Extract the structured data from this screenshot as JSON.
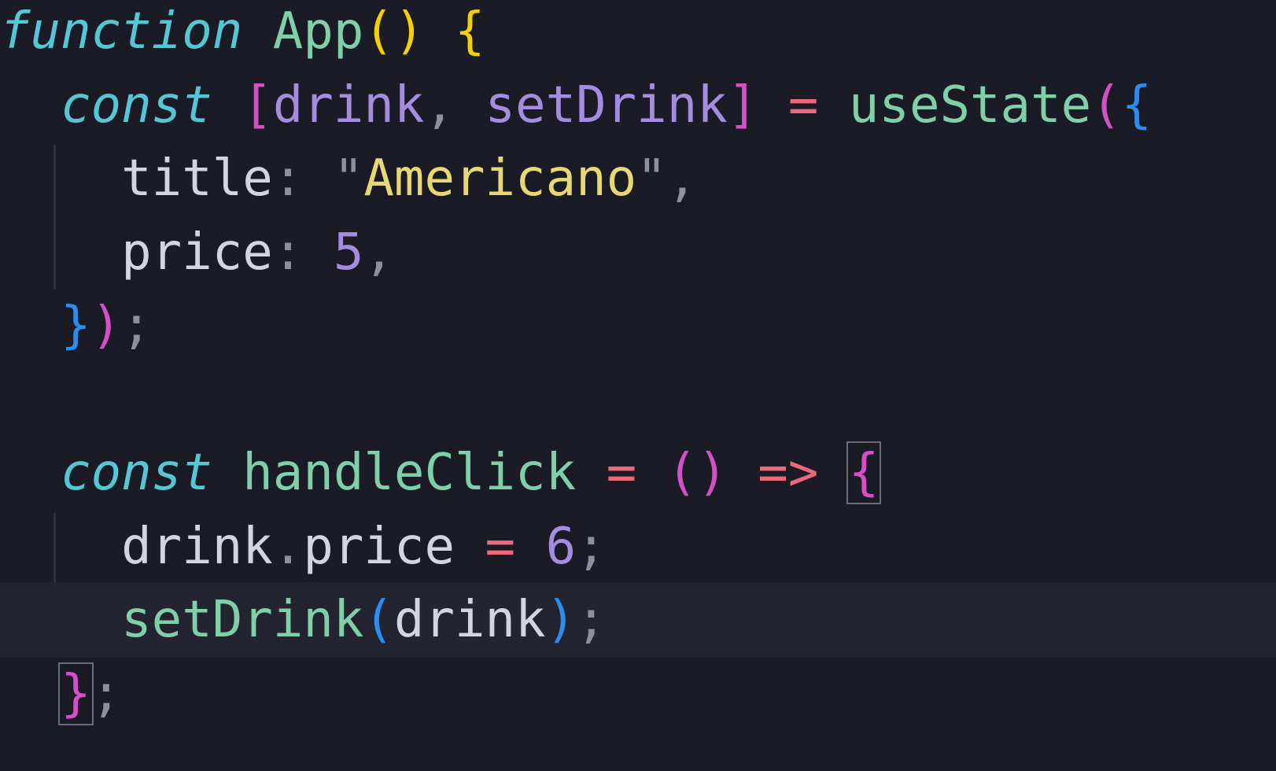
{
  "editor": {
    "colors": {
      "background": "#1a1b25",
      "current_line": "#23242f",
      "keyword": "#54c6d4",
      "function_name": "#7fcfa8",
      "variable": "#d2d4de",
      "destructure": "#a48ce0",
      "string": "#e8d873",
      "number": "#a48ce0",
      "operator": "#f0667a",
      "bracket_yellow": "#f5d000",
      "bracket_blue": "#2a8df0",
      "bracket_magenta": "#d44fc8",
      "punctuation": "#8e909c"
    },
    "lines": [
      {
        "tokens": [
          {
            "text": "function",
            "color": "#54c6d4",
            "italic": true
          },
          {
            "text": " ",
            "color": "#d2d4de"
          },
          {
            "text": "App",
            "color": "#7fcfa8"
          },
          {
            "text": "()",
            "color": "#f5d000"
          },
          {
            "text": " ",
            "color": "#d2d4de"
          },
          {
            "text": "{",
            "color": "#f5d000"
          }
        ]
      },
      {
        "tokens": [
          {
            "text": "  ",
            "color": "#d2d4de"
          },
          {
            "text": "const",
            "color": "#54c6d4",
            "italic": true
          },
          {
            "text": " ",
            "color": "#d2d4de"
          },
          {
            "text": "[",
            "color": "#d44fc8"
          },
          {
            "text": "drink",
            "color": "#a48ce0"
          },
          {
            "text": ",",
            "color": "#8e909c"
          },
          {
            "text": " ",
            "color": "#d2d4de"
          },
          {
            "text": "setDrink",
            "color": "#a48ce0"
          },
          {
            "text": "]",
            "color": "#d44fc8"
          },
          {
            "text": " ",
            "color": "#d2d4de"
          },
          {
            "text": "=",
            "color": "#f0667a"
          },
          {
            "text": " ",
            "color": "#d2d4de"
          },
          {
            "text": "useState",
            "color": "#7fcfa8"
          },
          {
            "text": "(",
            "color": "#d44fc8"
          },
          {
            "text": "{",
            "color": "#2a8df0"
          }
        ]
      },
      {
        "tokens": [
          {
            "text": "    ",
            "color": "#d2d4de"
          },
          {
            "text": "title",
            "color": "#d2d4de"
          },
          {
            "text": ":",
            "color": "#8e909c"
          },
          {
            "text": " ",
            "color": "#d2d4de"
          },
          {
            "text": "\"",
            "color": "#8e909c"
          },
          {
            "text": "Americano",
            "color": "#e8d873"
          },
          {
            "text": "\"",
            "color": "#8e909c"
          },
          {
            "text": ",",
            "color": "#8e909c"
          }
        ]
      },
      {
        "tokens": [
          {
            "text": "    ",
            "color": "#d2d4de"
          },
          {
            "text": "price",
            "color": "#d2d4de"
          },
          {
            "text": ":",
            "color": "#8e909c"
          },
          {
            "text": " ",
            "color": "#d2d4de"
          },
          {
            "text": "5",
            "color": "#a48ce0"
          },
          {
            "text": ",",
            "color": "#8e909c"
          }
        ]
      },
      {
        "tokens": [
          {
            "text": "  ",
            "color": "#d2d4de"
          },
          {
            "text": "}",
            "color": "#2a8df0"
          },
          {
            "text": ")",
            "color": "#d44fc8"
          },
          {
            "text": ";",
            "color": "#8e909c"
          }
        ]
      },
      {
        "tokens": []
      },
      {
        "tokens": [
          {
            "text": "  ",
            "color": "#d2d4de"
          },
          {
            "text": "const",
            "color": "#54c6d4",
            "italic": true
          },
          {
            "text": " ",
            "color": "#d2d4de"
          },
          {
            "text": "handleClick",
            "color": "#7fcfa8"
          },
          {
            "text": " ",
            "color": "#d2d4de"
          },
          {
            "text": "=",
            "color": "#f0667a"
          },
          {
            "text": " ",
            "color": "#d2d4de"
          },
          {
            "text": "()",
            "color": "#d44fc8"
          },
          {
            "text": " ",
            "color": "#d2d4de"
          },
          {
            "text": "=>",
            "color": "#f0667a"
          },
          {
            "text": " ",
            "color": "#d2d4de"
          },
          {
            "text": "{",
            "color": "#d44fc8",
            "boxed": true
          }
        ]
      },
      {
        "tokens": [
          {
            "text": "    ",
            "color": "#d2d4de"
          },
          {
            "text": "drink",
            "color": "#d2d4de"
          },
          {
            "text": ".",
            "color": "#8e909c"
          },
          {
            "text": "price",
            "color": "#d2d4de"
          },
          {
            "text": " ",
            "color": "#d2d4de"
          },
          {
            "text": "=",
            "color": "#f0667a"
          },
          {
            "text": " ",
            "color": "#d2d4de"
          },
          {
            "text": "6",
            "color": "#a48ce0"
          },
          {
            "text": ";",
            "color": "#8e909c"
          }
        ]
      },
      {
        "current": true,
        "tokens": [
          {
            "text": "    ",
            "color": "#d2d4de"
          },
          {
            "text": "setDrink",
            "color": "#7fcfa8"
          },
          {
            "text": "(",
            "color": "#2a8df0"
          },
          {
            "text": "drink",
            "color": "#d2d4de"
          },
          {
            "text": ")",
            "color": "#2a8df0"
          },
          {
            "text": ";",
            "color": "#8e909c"
          }
        ]
      },
      {
        "tokens": [
          {
            "text": "  ",
            "color": "#d2d4de"
          },
          {
            "text": "}",
            "color": "#d44fc8",
            "boxed": true
          },
          {
            "text": ";",
            "color": "#8e909c"
          }
        ]
      }
    ]
  }
}
